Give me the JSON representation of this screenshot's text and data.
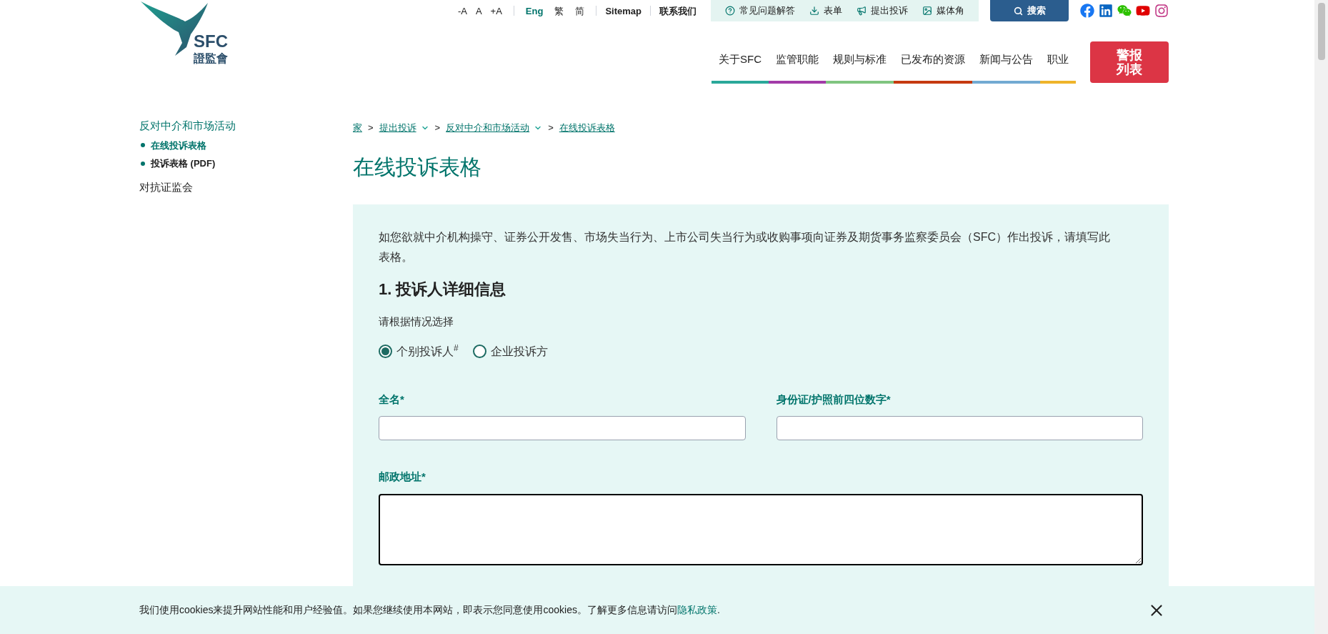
{
  "logo": {
    "abbr": "SFC",
    "chinese": "證監會"
  },
  "utility_bar": {
    "font_sizes": [
      "-A",
      "A",
      "+A"
    ],
    "languages": [
      {
        "label": "Eng",
        "highlighted": true
      },
      {
        "label": "繁",
        "highlighted": false
      },
      {
        "label": "简",
        "highlighted": false
      }
    ],
    "links": [
      "Sitemap",
      "联系我们"
    ],
    "quick_links": [
      "常见问题解答",
      "表单",
      "提出投诉",
      "媒体角"
    ],
    "search_button": "搜索"
  },
  "nav": [
    {
      "label": "关于SFC",
      "color": "#2aa89a"
    },
    {
      "label": "监管职能",
      "color": "#a23ba8"
    },
    {
      "label": "规则与标准",
      "color": "#80c580"
    },
    {
      "label": "已发布的资源",
      "color": "#c63a10"
    },
    {
      "label": "新闻与公告",
      "color": "#72aad2"
    },
    {
      "label": "职业",
      "color": "#efb42b"
    }
  ],
  "alert_button": [
    "警报",
    "列表"
  ],
  "sidebar": {
    "section": "反对中介和市场活动",
    "items": [
      {
        "label": "在线投诉表格",
        "selected": true
      },
      {
        "label": "投诉表格 (PDF)",
        "selected": false
      }
    ],
    "other": "对抗证监会"
  },
  "breadcrumb": {
    "separator": ">",
    "items": [
      {
        "label": "家",
        "dropdown": false
      },
      {
        "label": "提出投诉",
        "dropdown": true
      },
      {
        "label": "反对中介和市场活动",
        "dropdown": true
      },
      {
        "label": "在线投诉表格",
        "dropdown": false
      }
    ]
  },
  "page_title": "在线投诉表格",
  "form": {
    "intro": "如您欲就中介机构操守、证券公开发售、市场失当行为、上市公司失当行为或收购事项向证券及期货事务监察委员会（SFC）作出投诉，请填写此表格。",
    "section_title": "1. 投诉人详细信息",
    "prompt": "请根据情况选择",
    "options": [
      {
        "label": "个别投诉人$^{#}$",
        "selected": true
      },
      {
        "label": "企业投诉方",
        "selected": false
      }
    ],
    "fields": [
      {
        "label": "全名*",
        "kind": "input",
        "focused": false
      },
      {
        "label": "身份证/护照前四位数字*",
        "kind": "input",
        "focused": false
      },
      {
        "label": "邮政地址*",
        "kind": "textarea",
        "focused": true
      }
    ]
  },
  "cookie_banner": {
    "text": "我们使用cookies来提升网站性能和用户经验值。如果您继续使用本网站，即表示您同意使用cookies。了解更多信息请访问",
    "link": "隐私政策",
    "end": "."
  }
}
